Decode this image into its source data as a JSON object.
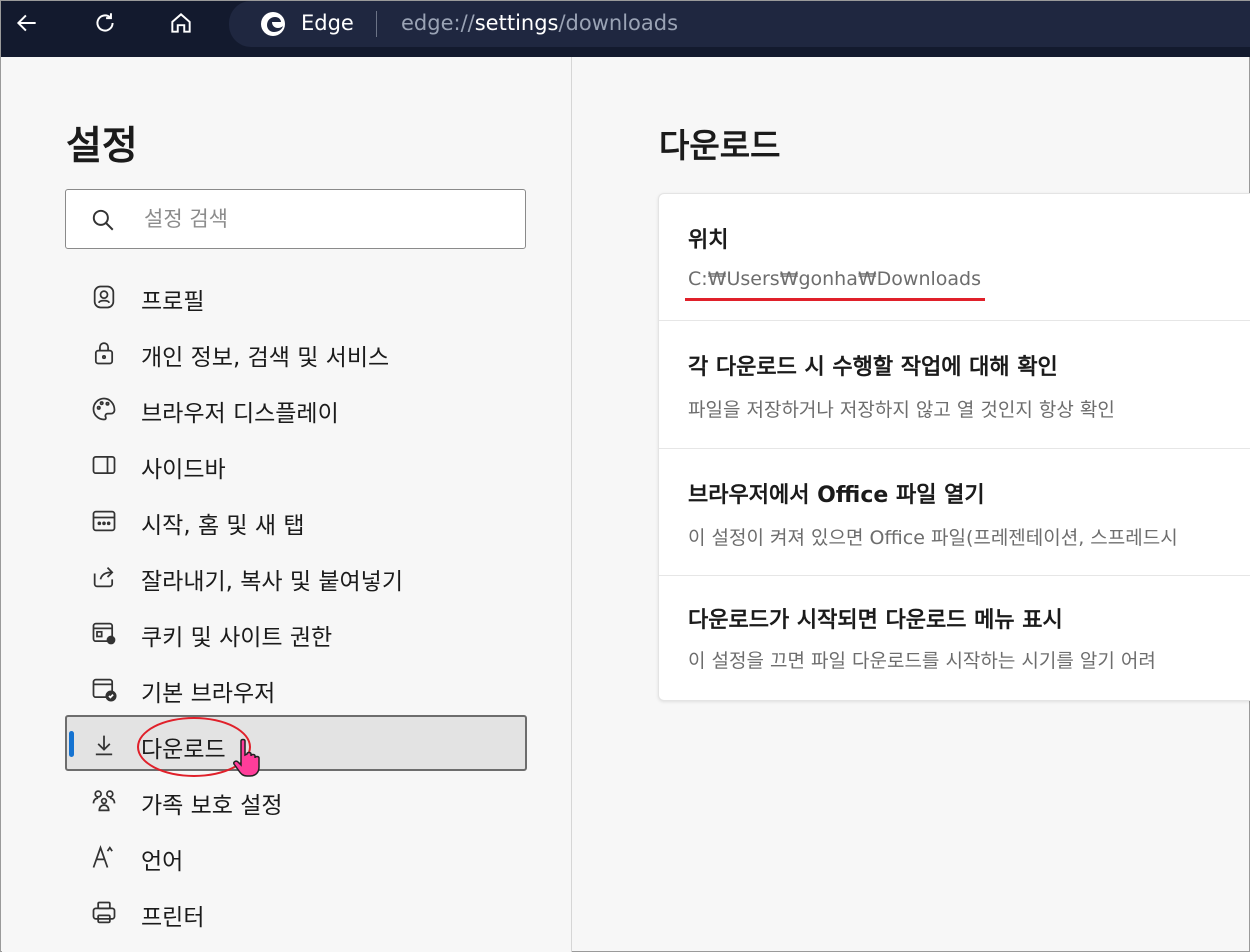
{
  "browser": {
    "app_name": "Edge",
    "url_prefix": "edge://",
    "url_strong": "settings",
    "url_suffix": "/downloads"
  },
  "sidebar": {
    "title": "설정",
    "search_placeholder": "설정 검색",
    "items": [
      {
        "label": "프로필",
        "icon": "profile-icon"
      },
      {
        "label": "개인 정보, 검색 및 서비스",
        "icon": "lock-icon"
      },
      {
        "label": "브라우저 디스플레이",
        "icon": "palette-icon"
      },
      {
        "label": "사이드바",
        "icon": "sidebar-icon"
      },
      {
        "label": "시작, 홈 및 새 탭",
        "icon": "start-page-icon"
      },
      {
        "label": "잘라내기, 복사 및 붙여넣기",
        "icon": "share-icon"
      },
      {
        "label": "쿠키 및 사이트 권한",
        "icon": "cookie-settings-icon"
      },
      {
        "label": "기본 브라우저",
        "icon": "default-browser-icon"
      },
      {
        "label": "다운로드",
        "icon": "download-icon",
        "active": true
      },
      {
        "label": "가족 보호 설정",
        "icon": "family-icon"
      },
      {
        "label": "언어",
        "icon": "language-icon"
      },
      {
        "label": "프린터",
        "icon": "printer-icon"
      }
    ]
  },
  "main": {
    "title": "다운로드",
    "rows": [
      {
        "title": "위치",
        "desc": "C:₩Users₩gonha₩Downloads"
      },
      {
        "title": "각 다운로드 시 수행할 작업에 대해 확인",
        "desc": "파일을 저장하거나 저장하지 않고 열 것인지 항상 확인"
      },
      {
        "title": "브라우저에서 Office 파일 열기",
        "desc": "이 설정이 켜져 있으면 Office 파일(프레젠테이션, 스프레드시"
      },
      {
        "title": "다운로드가 시작되면 다운로드 메뉴 표시",
        "desc": "이 설정을 끄면 파일 다운로드를 시작하는 시기를 알기 어려"
      }
    ]
  },
  "colors": {
    "topbar": "#131a2e",
    "accent": "#1573d1",
    "annotation_red": "#e0202a"
  }
}
